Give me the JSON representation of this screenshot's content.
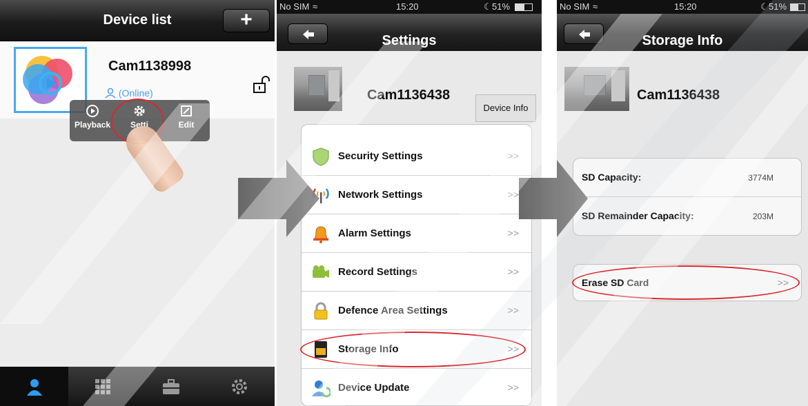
{
  "panel1": {
    "title": "Device list",
    "add_label": "+",
    "device_name": "Cam1138998",
    "device_status": "(Online)",
    "popup": {
      "playback": "Playback",
      "settings": "Setti",
      "edit": "Edit"
    },
    "tabs": [
      "contacts-icon",
      "grid-icon",
      "toolbox-icon",
      "gear-icon"
    ]
  },
  "panel2": {
    "status": {
      "carrier": "No SIM",
      "time": "15:20",
      "battery": "51%"
    },
    "title": "Settings",
    "device_name": "Cam1136438",
    "device_info_label": "Device Info",
    "items": [
      {
        "label": "Security Settings",
        "chevron": ">>"
      },
      {
        "label": "Network Settings",
        "chevron": ">>"
      },
      {
        "label": "Alarm Settings",
        "chevron": ">>"
      },
      {
        "label": "Record Settings",
        "chevron": ">>"
      },
      {
        "label": "Defence Area Settings",
        "chevron": ">>"
      },
      {
        "label": "Storage Info",
        "chevron": ">>"
      },
      {
        "label": "Device Update",
        "chevron": ">>"
      }
    ]
  },
  "panel3": {
    "status": {
      "carrier": "No SIM",
      "time": "15:20",
      "battery": "51%"
    },
    "title": "Storage Info",
    "device_name": "Cam1136438",
    "sd_capacity_label": "SD Capacity:",
    "sd_capacity_value": "3774M",
    "sd_remainder_label": "SD Remainder Capacity:",
    "sd_remainder_value": "203M",
    "erase_label": "Erase SD Card",
    "erase_chevron": ">>"
  },
  "colors": {
    "accent_blue": "#48a8f0",
    "highlight_red": "#d9282f",
    "navbar_dark": "#1c1c1c"
  }
}
